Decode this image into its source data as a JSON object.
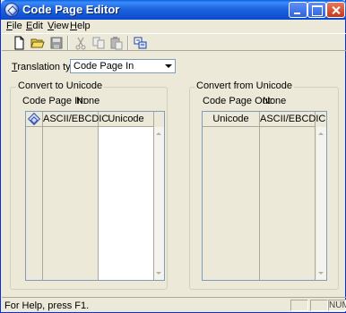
{
  "window": {
    "title": "Code Page Editor"
  },
  "menu": [
    {
      "label": "File",
      "mnemonic": "F",
      "rest": "ile"
    },
    {
      "label": "Edit",
      "mnemonic": "E",
      "rest": "dit"
    },
    {
      "label": "View",
      "mnemonic": "V",
      "rest": "iew"
    },
    {
      "label": "Help",
      "mnemonic": "H",
      "rest": "elp"
    }
  ],
  "toolbar": {
    "icons": [
      "new-file-icon",
      "open-folder-icon",
      "save-icon",
      "cut-icon",
      "copy-icon",
      "paste-icon",
      "convert-icon"
    ]
  },
  "translation": {
    "label_mnemonic": "T",
    "label_rest": "ranslation type:",
    "value": "Code Page In"
  },
  "convert_to": {
    "title": "Convert to Unicode",
    "info_label": "Code Page In:",
    "info_value": "None",
    "col1": "ASCII/EBCDIC",
    "col2": "Unicode"
  },
  "convert_from": {
    "title": "Convert from Unicode",
    "info_label": "Code Page Out:",
    "info_value": "None",
    "col1": "Unicode",
    "col2": "ASCII/EBCDIC"
  },
  "status": {
    "text": "For Help, press F1.",
    "panes": [
      "",
      "",
      "NUM"
    ]
  },
  "colors": {
    "titlebar": "#0B4BCB",
    "window_bg": "#ECE9D8",
    "border": "#7F9DB9"
  }
}
